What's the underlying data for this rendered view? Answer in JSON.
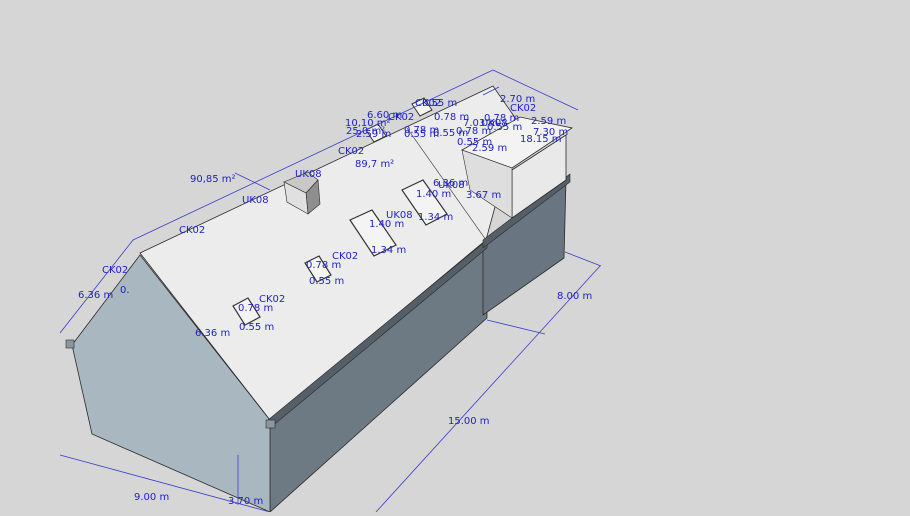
{
  "viewport_background": "#d6d6d6",
  "colors": {
    "annotation": "#2222c8",
    "roof": "#ececec",
    "gable": "#a9b6c0",
    "wall": "#6a7680",
    "dormer_wall": "#e8e8e8",
    "edge": "#2a2a2a"
  },
  "annotations": {
    "area_roof_left": "90,85 m²",
    "area_roof_center": "89,7 m²",
    "dim_6_36_left": "6.36 m",
    "dim_6_36_gable": "6.36 m",
    "dim_6_36_top": "6.36 m",
    "dim_9_00": "9.00 m",
    "dim_3_70": "3.70 m",
    "dim_15_00": "15.00 m",
    "dim_8_00": "8.00 m",
    "dim_3_67": "3.67 m",
    "dim_2_70": "2.70 m",
    "dim_2_59": "2.59 m",
    "dim_7_30": "7.30 m",
    "dim_18_15": "18.15 m",
    "dim_6_60": "6.60 m",
    "dim_partial": "0.",
    "win_1_w": "0.78 m",
    "win_1_h": "0.55 m",
    "win_2_w": "0.78 m",
    "win_2_h": "0.55 m",
    "win_3_w": "1.40 m",
    "win_3_h": "1.34 m",
    "win_4_w": "1.40 m",
    "win_4_h": "1.34 m",
    "label_ck02_a": "CK02",
    "label_ck02_b": "CK02",
    "label_ck02_c": "CK02",
    "label_ck02_d": "CK02",
    "label_ck02_e": "CK02",
    "label_ck02_f": "CK02",
    "label_ck02_g": "CK02",
    "label_ck02_h": "CK02",
    "label_uk08_a": "UK08",
    "label_uk08_b": "UK08",
    "label_uk08_c": "UK08",
    "label_uk08_d": "UK08",
    "label_uk08_e": "UK08",
    "cluster_1": "10,10 m²",
    "cluster_2": "25,0 m²",
    "cluster_3": "2.59 m",
    "cluster_4": "0.78 m",
    "cluster_5": "0.55 m",
    "cluster_6": "0.78 m",
    "cluster_7": "0.55 m",
    "cluster_8": "7.03 m",
    "cluster_9": "0.78 m",
    "cluster_10": "0.55 m",
    "cluster_11": "0.55 m",
    "cluster_12": "2.59 m",
    "cluster_13": "0.78 m",
    "cluster_14": "0.55 m"
  }
}
